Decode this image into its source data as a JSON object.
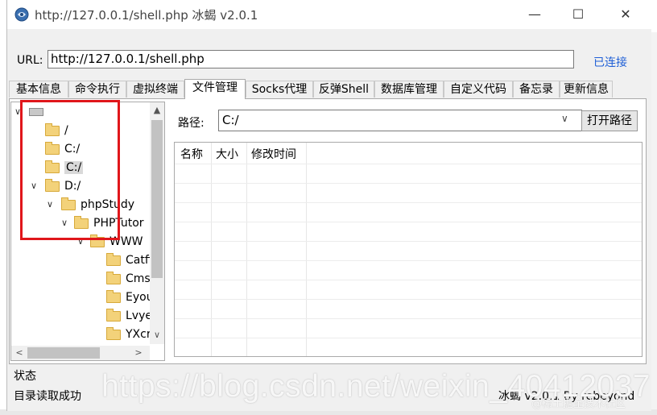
{
  "window": {
    "title": "http://127.0.0.1/shell.php   冰蝎 v2.0.1"
  },
  "url_bar": {
    "label": "URL:",
    "value": "http://127.0.0.1/shell.php",
    "status": "已连接",
    "status_color": "#1f5fd6"
  },
  "tabs": [
    {
      "label": "基本信息"
    },
    {
      "label": "命令执行"
    },
    {
      "label": "虚拟终端"
    },
    {
      "label": "文件管理",
      "active": true
    },
    {
      "label": "Socks代理"
    },
    {
      "label": "反弹Shell"
    },
    {
      "label": "数据库管理"
    },
    {
      "label": "自定义代码"
    },
    {
      "label": "备忘录"
    },
    {
      "label": "更新信息"
    }
  ],
  "tree": {
    "items": [
      {
        "label": "",
        "icon": "drive-icon"
      },
      {
        "label": "/",
        "icon": "folder-icon"
      },
      {
        "label": "C:/",
        "icon": "folder-icon"
      },
      {
        "label": "C:/",
        "icon": "folder-icon",
        "selected": true
      },
      {
        "label": "D:/",
        "icon": "folder-icon"
      },
      {
        "label": "phpStudy",
        "icon": "folder-icon"
      },
      {
        "label": "PHPTutor",
        "icon": "folder-icon"
      },
      {
        "label": "WWW",
        "icon": "folder-icon"
      },
      {
        "label": "Catfi",
        "icon": "folder-icon"
      },
      {
        "label": "Cms",
        "icon": "folder-icon"
      },
      {
        "label": "Eyou",
        "icon": "folder-icon"
      },
      {
        "label": "Lvye",
        "icon": "folder-icon"
      },
      {
        "label": "YXcr",
        "icon": "folder-icon"
      }
    ]
  },
  "path_bar": {
    "label": "路径:",
    "value": "C:/",
    "open_button": "打开路径"
  },
  "file_table": {
    "columns": [
      "名称",
      "大小",
      "修改时间"
    ]
  },
  "status": {
    "title": "状态",
    "message": "目录读取成功",
    "footer": "冰蝎 v2.0.1  By rebeyond"
  },
  "watermark": {
    "url": "https://blog.csdn.net/weixin_40412037",
    "cn": "@稀土掘金技术社区"
  },
  "annotation": {
    "color": "#e0161b"
  }
}
